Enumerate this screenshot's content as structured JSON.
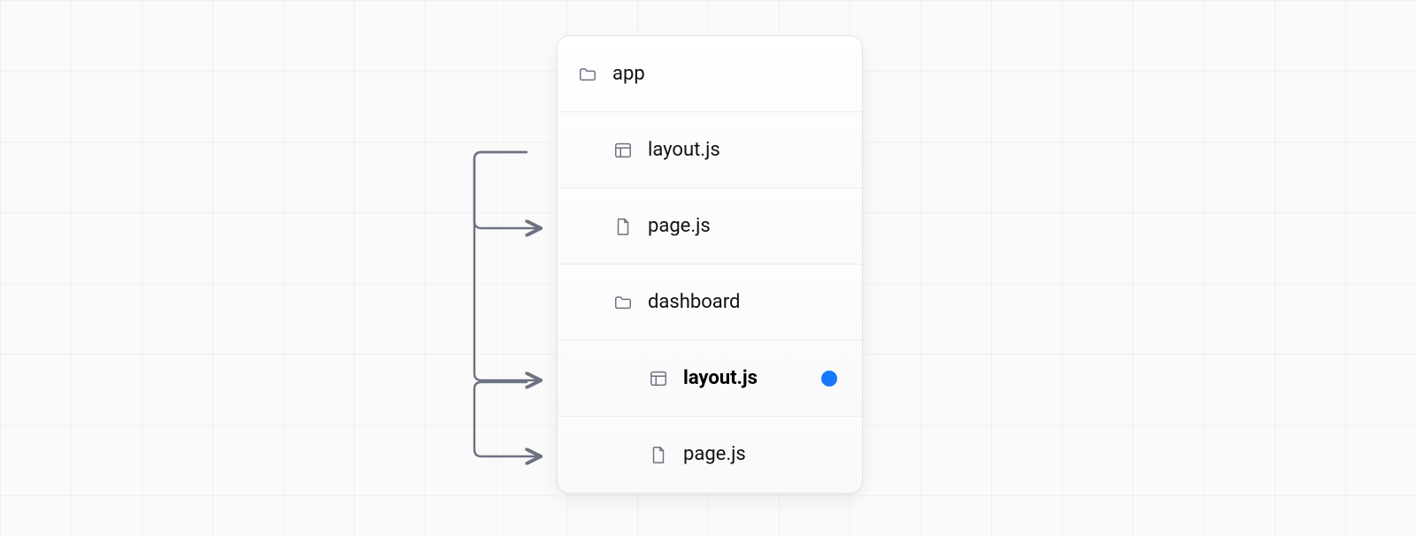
{
  "tree": {
    "root": {
      "label": "app",
      "icon": "folder"
    },
    "items": [
      {
        "label": "layout.js",
        "icon": "layout",
        "depth": 1
      },
      {
        "label": "page.js",
        "icon": "file",
        "depth": 1
      },
      {
        "label": "dashboard",
        "icon": "folder",
        "depth": 1
      },
      {
        "label": "layout.js",
        "icon": "layout",
        "depth": 2,
        "bold": true,
        "marked": true
      },
      {
        "label": "page.js",
        "icon": "file",
        "depth": 2
      }
    ]
  },
  "colors": {
    "marker": "#1677ff"
  }
}
